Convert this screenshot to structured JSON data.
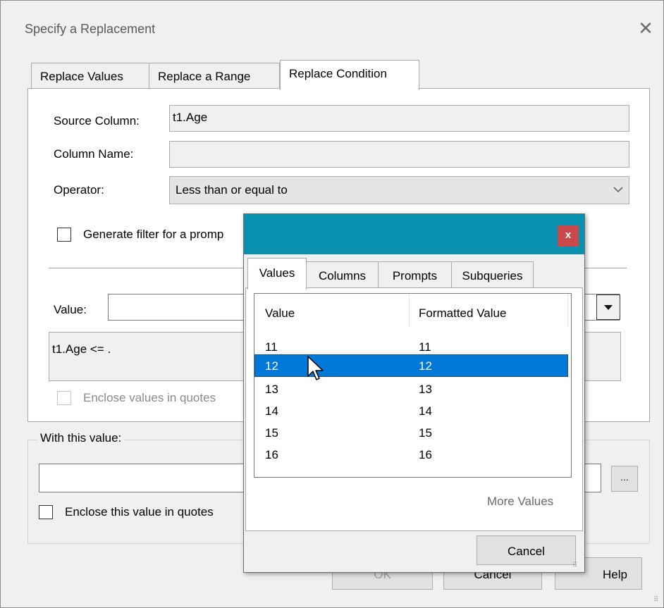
{
  "dialog": {
    "title": "Specify a Replacement",
    "close_glyph": "✕",
    "tabs": [
      {
        "label": "Replace Values"
      },
      {
        "label": "Replace a Range"
      },
      {
        "label": "Replace Condition"
      }
    ],
    "active_tab": "Replace Condition"
  },
  "condition": {
    "source_column_label": "Source Column:",
    "source_column_value": "t1.Age",
    "column_name_label": "Column Name:",
    "column_name_value": "",
    "operator_label": "Operator:",
    "operator_value": "Less than or equal to",
    "generate_filter_label": "Generate filter for a promp",
    "generate_filter_checked": false,
    "value_label": "Value:",
    "value_input": "",
    "expression": "t1.Age <= .",
    "enclose_quotes_label": "Enclose values in quotes",
    "enclose_quotes_enabled": false
  },
  "with_value": {
    "group_label": "With this value:",
    "input_value": "",
    "browse_label": "...",
    "enclose_label": "Enclose this value in quotes",
    "enclose_checked": false
  },
  "buttons": {
    "ok_label": "OK",
    "cancel_label": "Cancel",
    "help_label": "Help"
  },
  "popup": {
    "close_glyph": "x",
    "tabs": [
      {
        "label": "Values"
      },
      {
        "label": "Columns"
      },
      {
        "label": "Prompts"
      },
      {
        "label": "Subqueries"
      }
    ],
    "active_tab": "Values",
    "columns": [
      "Value",
      "Formatted Value"
    ],
    "rows": [
      {
        "value": "11",
        "formatted": "11"
      },
      {
        "value": "12",
        "formatted": "12"
      },
      {
        "value": "13",
        "formatted": "13"
      },
      {
        "value": "14",
        "formatted": "14"
      },
      {
        "value": "15",
        "formatted": "15"
      },
      {
        "value": "16",
        "formatted": "16"
      }
    ],
    "selected_row": 1,
    "more_values_label": "More Values",
    "cancel_label": "Cancel"
  },
  "colors": {
    "popup_titlebar": "#0a91b1",
    "popup_close": "#c9484a",
    "selection": "#0078d7"
  },
  "icons": {
    "dialog_close": "close-icon",
    "operator_dropdown": "chevron-down-icon",
    "value_dropdown": "dropdown-arrow-icon",
    "cursor": "mouse-pointer-icon"
  }
}
